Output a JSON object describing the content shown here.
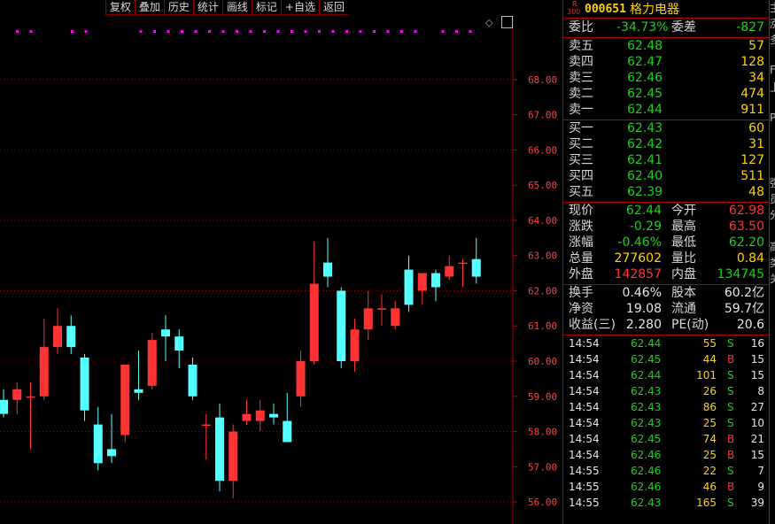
{
  "toolbar": {
    "buttons": [
      "复权",
      "叠加",
      "历史",
      "统计",
      "画线",
      "标记",
      "+自选",
      "返回"
    ]
  },
  "chart": {
    "price_labels": [
      "68.00",
      "67.00",
      "66.00",
      "65.00",
      "64.00",
      "63.00",
      "62.00",
      "61.00",
      "60.00",
      "59.00",
      "58.00",
      "57.00",
      "56.00"
    ],
    "colors": {
      "up": "#ff3333",
      "down": "#54ffff",
      "grid": "#8b0000",
      "axis": "#b00000",
      "label": "#ff4040",
      "marker": "#ff00ff"
    }
  },
  "chart_data": {
    "type": "candlestick",
    "ylim": [
      55.8,
      68.5
    ],
    "candles": [
      {
        "o": 58.9,
        "h": 59.2,
        "l": 58.4,
        "c": 58.5
      },
      {
        "o": 58.9,
        "h": 59.4,
        "l": 58.5,
        "c": 59.2
      },
      {
        "o": 59.0,
        "h": 59.4,
        "l": 57.5,
        "c": 59.0
      },
      {
        "o": 59.0,
        "h": 61.2,
        "l": 58.9,
        "c": 60.4
      },
      {
        "o": 60.4,
        "h": 61.5,
        "l": 60.2,
        "c": 61.0
      },
      {
        "o": 61.0,
        "h": 61.3,
        "l": 60.2,
        "c": 60.4
      },
      {
        "o": 60.1,
        "h": 60.2,
        "l": 58.3,
        "c": 58.6
      },
      {
        "o": 58.2,
        "h": 58.7,
        "l": 56.9,
        "c": 57.1
      },
      {
        "o": 57.5,
        "h": 58.5,
        "l": 57.1,
        "c": 57.3
      },
      {
        "o": 57.9,
        "h": 59.5,
        "l": 57.7,
        "c": 59.9
      },
      {
        "o": 59.2,
        "h": 60.3,
        "l": 58.9,
        "c": 59.1
      },
      {
        "o": 59.3,
        "h": 60.8,
        "l": 59.2,
        "c": 60.6
      },
      {
        "o": 60.9,
        "h": 61.3,
        "l": 60.0,
        "c": 60.7
      },
      {
        "o": 60.7,
        "h": 60.9,
        "l": 59.8,
        "c": 60.3
      },
      {
        "o": 59.9,
        "h": 60.1,
        "l": 58.9,
        "c": 59.0
      },
      {
        "o": 58.2,
        "h": 58.5,
        "l": 57.2,
        "c": 58.2
      },
      {
        "o": 58.4,
        "h": 58.8,
        "l": 56.3,
        "c": 56.6
      },
      {
        "o": 56.6,
        "h": 58.2,
        "l": 56.1,
        "c": 58.0
      },
      {
        "o": 58.3,
        "h": 58.9,
        "l": 58.2,
        "c": 58.5
      },
      {
        "o": 58.3,
        "h": 58.9,
        "l": 58.0,
        "c": 58.6
      },
      {
        "o": 58.5,
        "h": 58.8,
        "l": 58.2,
        "c": 58.4
      },
      {
        "o": 58.3,
        "h": 59.1,
        "l": 58.0,
        "c": 57.7
      },
      {
        "o": 59.0,
        "h": 60.3,
        "l": 58.7,
        "c": 60.0
      },
      {
        "o": 60.0,
        "h": 63.4,
        "l": 59.9,
        "c": 62.2
      },
      {
        "o": 62.8,
        "h": 63.5,
        "l": 62.1,
        "c": 62.4
      },
      {
        "o": 62.0,
        "h": 62.1,
        "l": 59.8,
        "c": 60.0
      },
      {
        "o": 60.0,
        "h": 61.2,
        "l": 59.7,
        "c": 60.9
      },
      {
        "o": 60.9,
        "h": 62.0,
        "l": 60.6,
        "c": 61.5
      },
      {
        "o": 61.5,
        "h": 61.9,
        "l": 61.0,
        "c": 61.5
      },
      {
        "o": 61.0,
        "h": 61.7,
        "l": 60.9,
        "c": 61.5
      },
      {
        "o": 62.6,
        "h": 63.0,
        "l": 61.4,
        "c": 61.6
      },
      {
        "o": 62.0,
        "h": 62.5,
        "l": 61.6,
        "c": 62.5
      },
      {
        "o": 62.5,
        "h": 62.6,
        "l": 61.7,
        "c": 62.1
      },
      {
        "o": 62.4,
        "h": 63.0,
        "l": 62.3,
        "c": 62.7
      },
      {
        "o": 62.8,
        "h": 62.9,
        "l": 62.1,
        "c": 62.8
      },
      {
        "o": 62.9,
        "h": 63.5,
        "l": 62.2,
        "c": 62.4
      }
    ]
  },
  "header": {
    "badge_r": "R",
    "badge_n": "300",
    "code": "000651",
    "name": "格力电器"
  },
  "committee": {
    "ratio_label": "委比",
    "ratio": "-34.73%",
    "diff_label": "委差",
    "diff": "-827"
  },
  "sell": [
    {
      "label": "卖五",
      "price": "62.48",
      "vol": "57"
    },
    {
      "label": "卖四",
      "price": "62.47",
      "vol": "128"
    },
    {
      "label": "卖三",
      "price": "62.46",
      "vol": "34"
    },
    {
      "label": "卖二",
      "price": "62.45",
      "vol": "474"
    },
    {
      "label": "卖一",
      "price": "62.44",
      "vol": "911"
    }
  ],
  "buy": [
    {
      "label": "买一",
      "price": "62.43",
      "vol": "60"
    },
    {
      "label": "买二",
      "price": "62.42",
      "vol": "31"
    },
    {
      "label": "买三",
      "price": "62.41",
      "vol": "127"
    },
    {
      "label": "买四",
      "price": "62.40",
      "vol": "511"
    },
    {
      "label": "买五",
      "price": "62.39",
      "vol": "48"
    }
  ],
  "quote": [
    {
      "l1": "现价",
      "v1": "62.44",
      "c1": "g",
      "l2": "今开",
      "v2": "62.98",
      "c2": "r"
    },
    {
      "l1": "涨跌",
      "v1": "-0.29",
      "c1": "g",
      "l2": "最高",
      "v2": "63.50",
      "c2": "r"
    },
    {
      "l1": "涨幅",
      "v1": "-0.46%",
      "c1": "g",
      "l2": "最低",
      "v2": "62.20",
      "c2": "g"
    },
    {
      "l1": "总量",
      "v1": "277602",
      "c1": "y",
      "l2": "量比",
      "v2": "0.84",
      "c2": "y"
    },
    {
      "l1": "外盘",
      "v1": "142857",
      "c1": "r",
      "l2": "内盘",
      "v2": "134745",
      "c2": "g"
    }
  ],
  "finance": [
    {
      "l1": "换手",
      "v1": "0.46%",
      "l2": "股本",
      "v2": "60.2亿"
    },
    {
      "l1": "净资",
      "v1": "19.08",
      "l2": "流通",
      "v2": "59.7亿"
    },
    {
      "l1": "收益(三)",
      "v1": "2.280",
      "l2": "PE(动)",
      "v2": "20.6"
    }
  ],
  "ticks": [
    {
      "time": "14:54",
      "price": "62.44",
      "pc": "g",
      "vol": "55",
      "side": "S",
      "n": "16"
    },
    {
      "time": "14:54",
      "price": "62.45",
      "pc": "g",
      "vol": "44",
      "side": "B",
      "n": "15"
    },
    {
      "time": "14:54",
      "price": "62.44",
      "pc": "g",
      "vol": "101",
      "side": "S",
      "n": "15"
    },
    {
      "time": "14:54",
      "price": "62.43",
      "pc": "g",
      "vol": "26",
      "side": "S",
      "n": "8"
    },
    {
      "time": "14:54",
      "price": "62.43",
      "pc": "g",
      "vol": "86",
      "side": "S",
      "n": "27"
    },
    {
      "time": "14:54",
      "price": "62.43",
      "pc": "g",
      "vol": "25",
      "side": "S",
      "n": "10"
    },
    {
      "time": "14:54",
      "price": "62.45",
      "pc": "g",
      "vol": "74",
      "side": "B",
      "n": "21"
    },
    {
      "time": "14:54",
      "price": "62.46",
      "pc": "g",
      "vol": "25",
      "side": "B",
      "n": "15"
    },
    {
      "time": "14:55",
      "price": "62.46",
      "pc": "g",
      "vol": "22",
      "side": "S",
      "n": "7"
    },
    {
      "time": "14:55",
      "price": "62.46",
      "pc": "g",
      "vol": "46",
      "side": "B",
      "n": "9"
    },
    {
      "time": "14:55",
      "price": "62.43",
      "pc": "g",
      "vol": "165",
      "side": "S",
      "n": "39"
    }
  ],
  "edge_chars": [
    "主",
    "涨",
    "多",
    "",
    "F",
    "上",
    "",
    "P",
    "",
    "",
    "",
    "强",
    "员",
    "分",
    "",
    "高",
    "类",
    "关"
  ]
}
